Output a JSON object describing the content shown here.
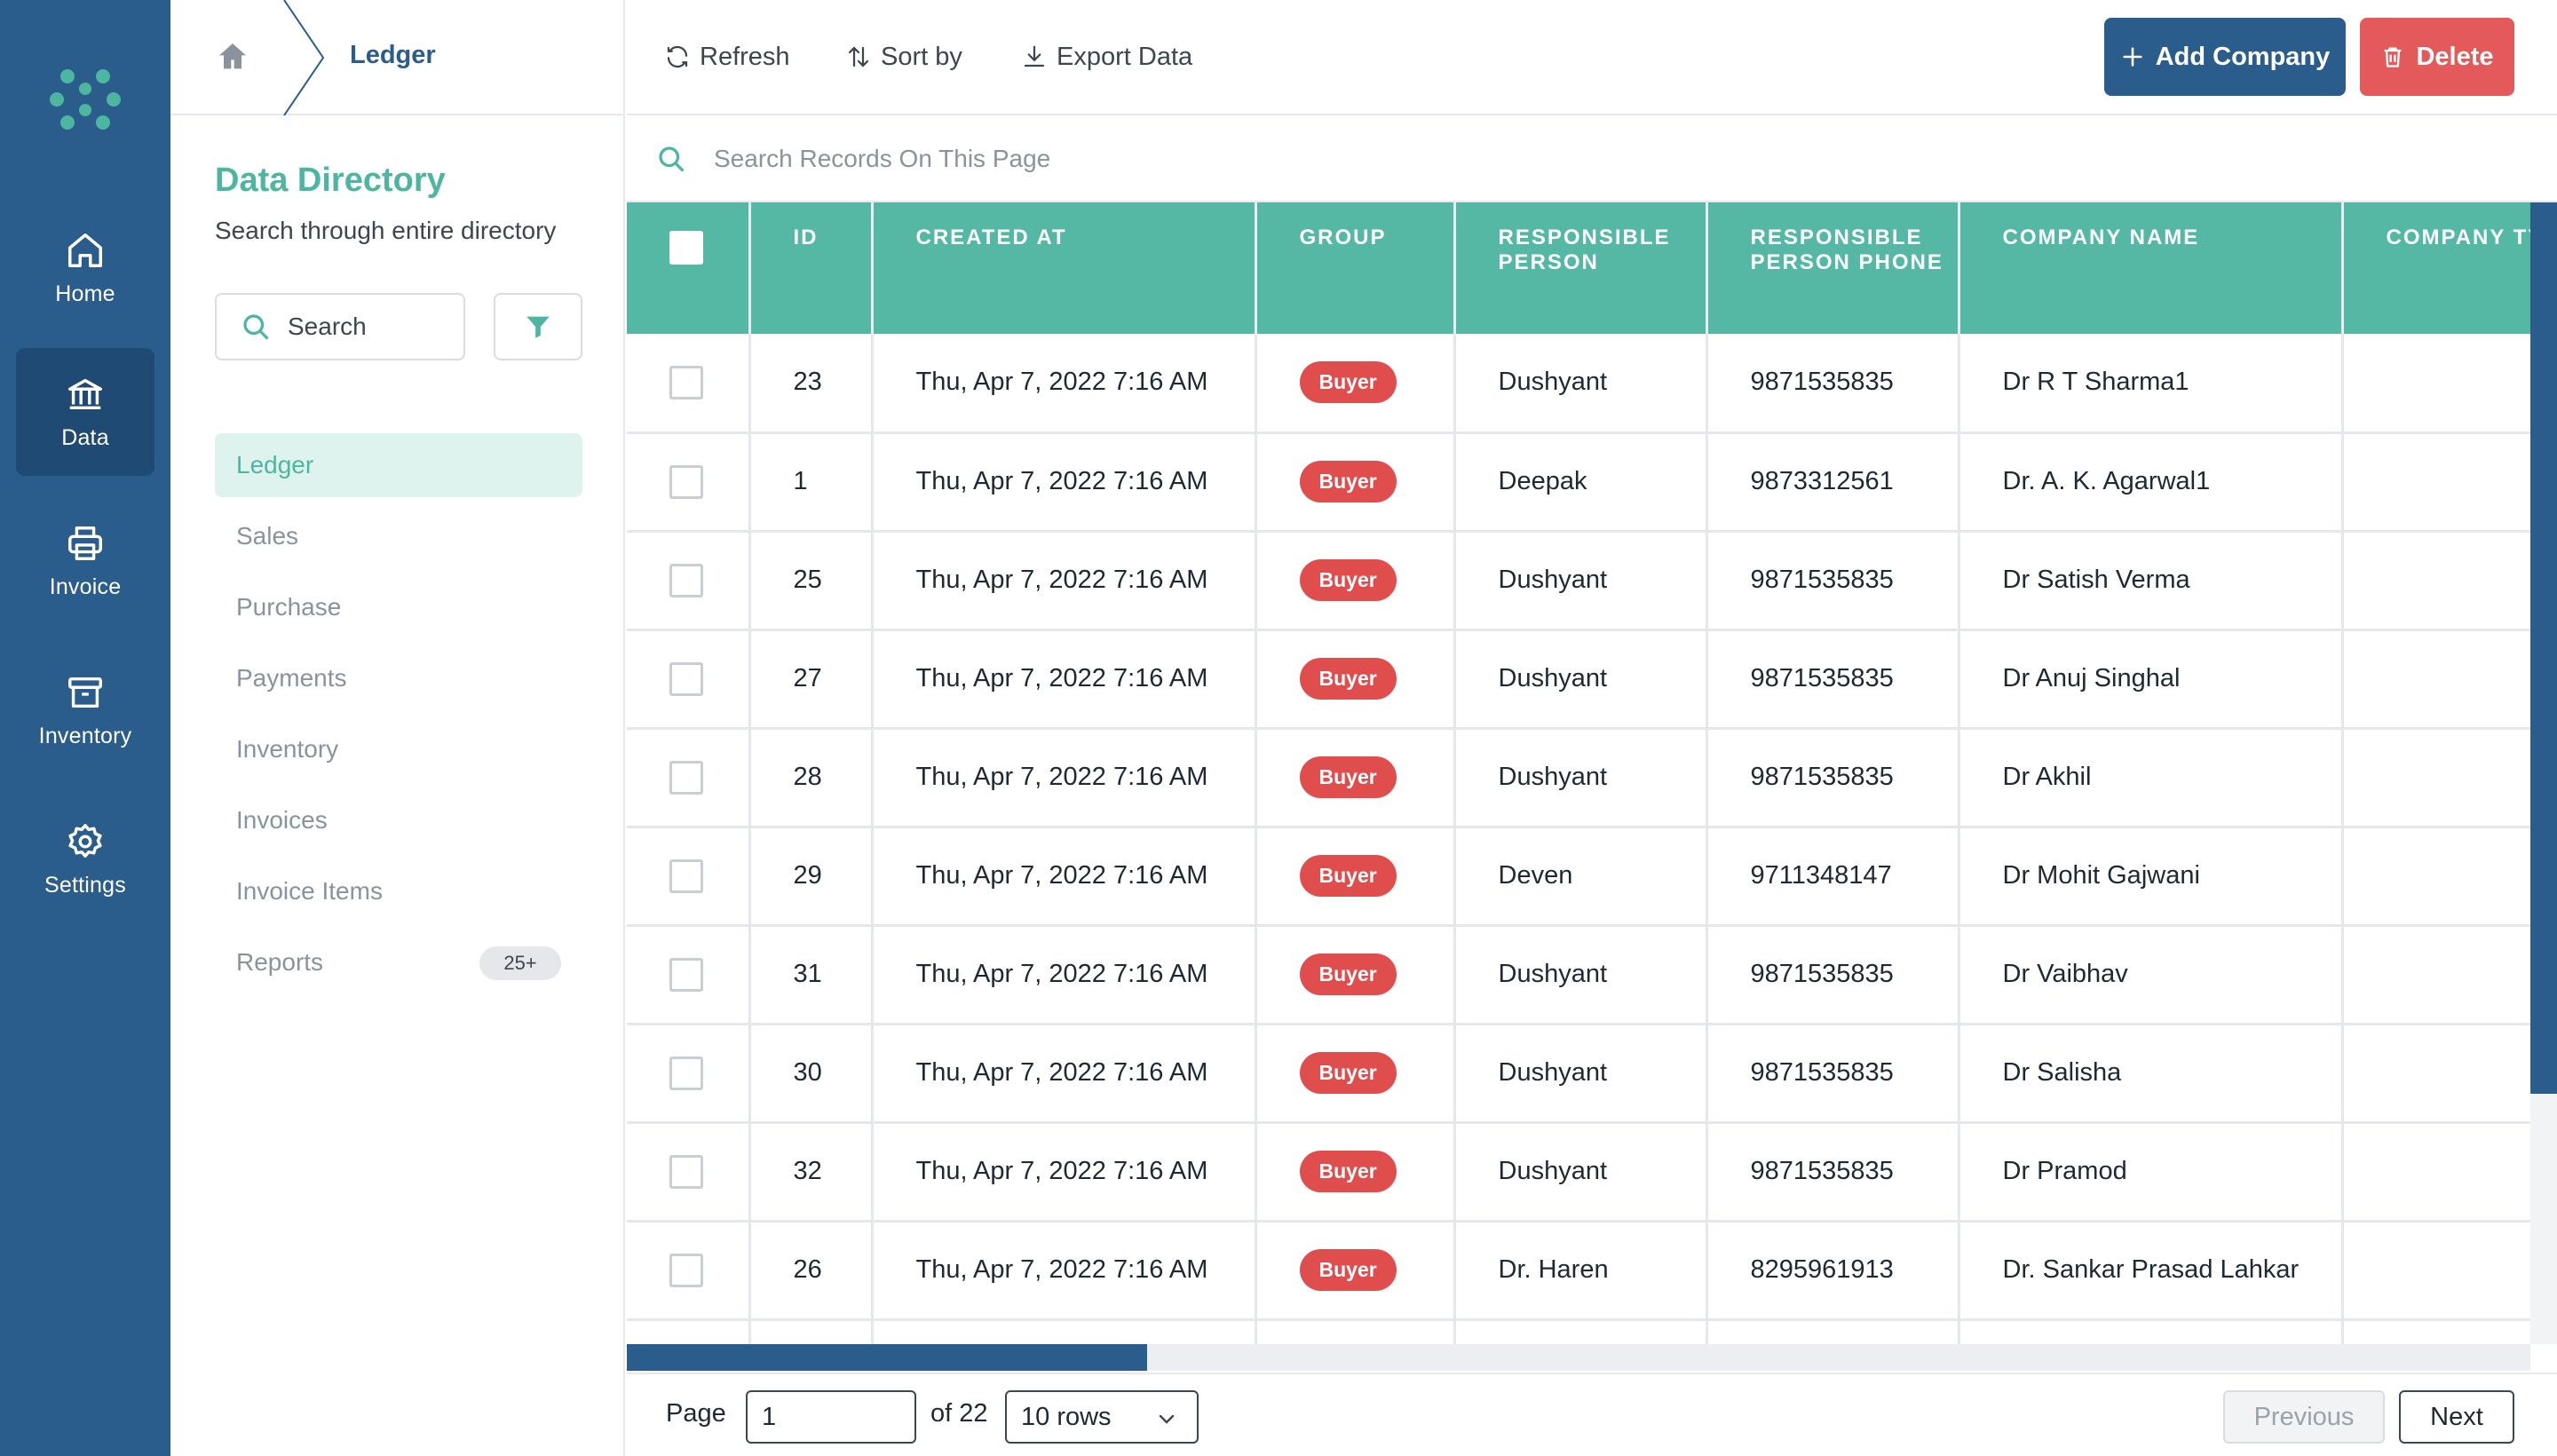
{
  "rail": {
    "items": [
      {
        "label": "Home",
        "icon": "home-icon"
      },
      {
        "label": "Data",
        "icon": "bank-icon",
        "active": true
      },
      {
        "label": "Invoice",
        "icon": "printer-icon"
      },
      {
        "label": "Inventory",
        "icon": "archive-icon"
      },
      {
        "label": "Settings",
        "icon": "gear-icon"
      }
    ]
  },
  "breadcrumb": {
    "current": "Ledger"
  },
  "directory": {
    "title": "Data Directory",
    "subtitle": "Search through entire directory",
    "search_placeholder": "Search",
    "nav": [
      {
        "label": "Ledger",
        "active": true
      },
      {
        "label": "Sales"
      },
      {
        "label": "Purchase"
      },
      {
        "label": "Payments"
      },
      {
        "label": "Inventory"
      },
      {
        "label": "Invoices"
      },
      {
        "label": "Invoice Items"
      },
      {
        "label": "Reports",
        "badge": "25+"
      }
    ]
  },
  "toolbar": {
    "refresh": "Refresh",
    "sort": "Sort by",
    "export": "Export Data",
    "add": "Add Company",
    "delete": "Delete"
  },
  "record_search": {
    "placeholder": "Search Records On This Page"
  },
  "table": {
    "columns": [
      "ID",
      "CREATED AT",
      "GROUP",
      "RESPONSIBLE PERSON",
      "RESPONSIBLE PERSON PHONE",
      "COMPANY NAME",
      "COMPANY TYPE"
    ],
    "rows": [
      {
        "id": "23",
        "created": "Thu, Apr 7, 2022 7:16 AM",
        "group": "Buyer",
        "person": "Dushyant",
        "phone": "9871535835",
        "company": "Dr R T Sharma1"
      },
      {
        "id": "1",
        "created": "Thu, Apr 7, 2022 7:16 AM",
        "group": "Buyer",
        "person": "Deepak",
        "phone": "9873312561",
        "company": "Dr. A. K. Agarwal1"
      },
      {
        "id": "25",
        "created": "Thu, Apr 7, 2022 7:16 AM",
        "group": "Buyer",
        "person": "Dushyant",
        "phone": "9871535835",
        "company": "Dr Satish Verma"
      },
      {
        "id": "27",
        "created": "Thu, Apr 7, 2022 7:16 AM",
        "group": "Buyer",
        "person": "Dushyant",
        "phone": "9871535835",
        "company": "Dr Anuj Singhal"
      },
      {
        "id": "28",
        "created": "Thu, Apr 7, 2022 7:16 AM",
        "group": "Buyer",
        "person": "Dushyant",
        "phone": "9871535835",
        "company": "Dr Akhil"
      },
      {
        "id": "29",
        "created": "Thu, Apr 7, 2022 7:16 AM",
        "group": "Buyer",
        "person": "Deven",
        "phone": "9711348147",
        "company": "Dr Mohit Gajwani"
      },
      {
        "id": "31",
        "created": "Thu, Apr 7, 2022 7:16 AM",
        "group": "Buyer",
        "person": "Dushyant",
        "phone": "9871535835",
        "company": "Dr Vaibhav"
      },
      {
        "id": "30",
        "created": "Thu, Apr 7, 2022 7:16 AM",
        "group": "Buyer",
        "person": "Dushyant",
        "phone": "9871535835",
        "company": "Dr Salisha"
      },
      {
        "id": "32",
        "created": "Thu, Apr 7, 2022 7:16 AM",
        "group": "Buyer",
        "person": "Dushyant",
        "phone": "9871535835",
        "company": "Dr Pramod"
      },
      {
        "id": "26",
        "created": "Thu, Apr 7, 2022 7:16 AM",
        "group": "Buyer",
        "person": "Dr. Haren",
        "phone": "8295961913",
        "company": "Dr. Sankar Prasad Lahkar"
      },
      {
        "id": "",
        "created": "",
        "group": "",
        "person": "",
        "phone": "",
        "company": ""
      }
    ]
  },
  "pager": {
    "page_label": "Page",
    "page_value": "1",
    "of_label": "of 22",
    "rows_option": "10 rows",
    "previous": "Previous",
    "next": "Next"
  },
  "colors": {
    "rail": "#2a5c8c",
    "accent": "#4db6a0",
    "header": "#55b8a4",
    "danger": "#e45a5a"
  }
}
